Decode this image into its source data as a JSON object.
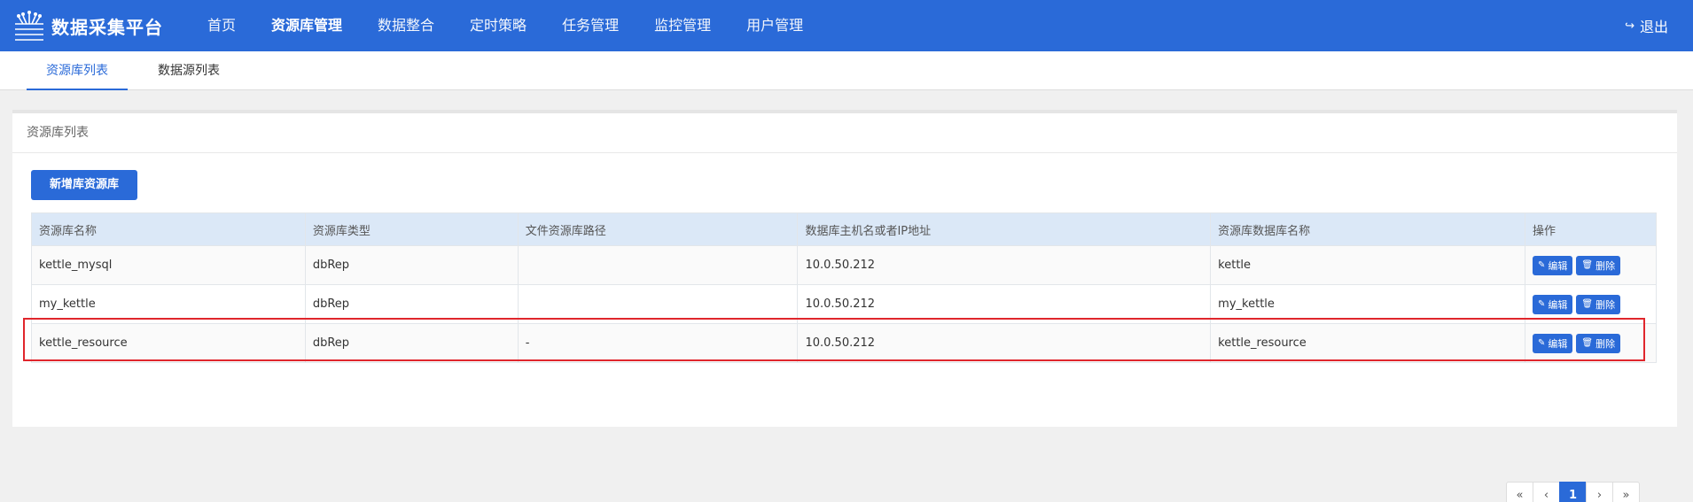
{
  "navbar": {
    "brand_title": "数据采集平台",
    "items": [
      {
        "label": "首页"
      },
      {
        "label": "资源库管理"
      },
      {
        "label": "数据整合"
      },
      {
        "label": "定时策略"
      },
      {
        "label": "任务管理"
      },
      {
        "label": "监控管理"
      },
      {
        "label": "用户管理"
      }
    ],
    "active_index": 1,
    "logout_label": "退出",
    "color": "#2a6ad8"
  },
  "subtabs": [
    {
      "label": "资源库列表"
    },
    {
      "label": "数据源列表"
    }
  ],
  "panel": {
    "heading": "资源库列表",
    "add_button": "新增库资源库"
  },
  "table": {
    "headers": [
      "资源库名称",
      "资源库类型",
      "文件资源库路径",
      "数据库主机名或者IP地址",
      "资源库数据库名称",
      "操作"
    ],
    "rows": [
      {
        "name": "kettle_mysql",
        "type": "dbRep",
        "path": "",
        "host": "10.0.50.212",
        "dbname": "kettle"
      },
      {
        "name": "my_kettle",
        "type": "dbRep",
        "path": "",
        "host": "10.0.50.212",
        "dbname": "my_kettle"
      },
      {
        "name": "kettle_resource",
        "type": "dbRep",
        "path": "-",
        "host": "10.0.50.212",
        "dbname": "kettle_resource"
      }
    ],
    "edit_label": "编辑",
    "delete_label": "删除",
    "edit_icon": "edit-icon",
    "delete_icon": "trash-icon"
  },
  "pagination": {
    "first": "«",
    "prev": "‹",
    "current": "1",
    "next": "›",
    "last": "»"
  },
  "highlight_color": "#e0262c"
}
